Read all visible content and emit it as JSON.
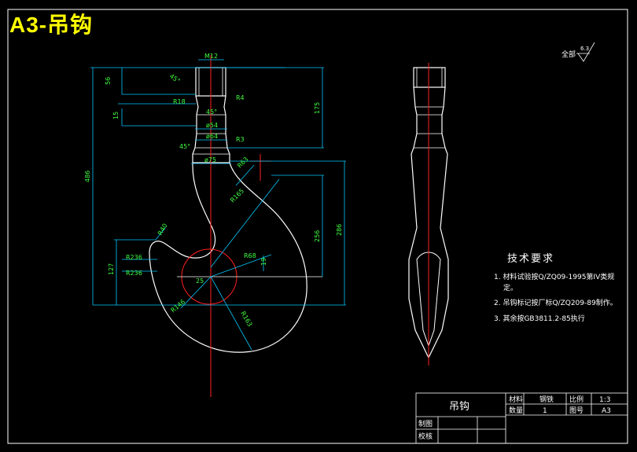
{
  "sheet_title": "A3-吊钩",
  "surface_finish": {
    "label": "全部",
    "value": "6.3"
  },
  "dimensions": {
    "m": "M12",
    "d45_top": "45°",
    "d56": "56",
    "r4": "R4",
    "r18": "R18",
    "d15": "15",
    "d45_mid": "45°",
    "phi54": "ø54",
    "phi64": "ø64",
    "r3": "R3",
    "d45_left": "45°",
    "phi75": "ø75",
    "d175": "175",
    "r63": "R63",
    "r165": "R165",
    "r40": "R40",
    "r236a": "R236",
    "r236b": "R236",
    "d127": "127",
    "d486": "486",
    "d256": "256",
    "d286": "286",
    "r68": "R68",
    "d19": "19",
    "d25": "25",
    "r146": "R146",
    "r163": "R163"
  },
  "tech_requirements": {
    "title": "技术要求",
    "items": [
      "1. 材料试验按Q/ZQ09-1995第IV类规",
      "定。",
      "2. 吊钩标记按厂标Q/ZQ209-89制作。",
      "3. 其余按GB3811.2-85执行"
    ]
  },
  "title_block": {
    "part_name": "吊钩",
    "material_label": "材料",
    "material_value": "钢铁",
    "scale_label": "比例",
    "scale_value": "1:3",
    "quantity_label": "数量",
    "quantity_value": "1",
    "drawing_no_label": "图号",
    "drawing_no_value": "A3",
    "drawn_label": "制图",
    "checked_label": "校核"
  }
}
